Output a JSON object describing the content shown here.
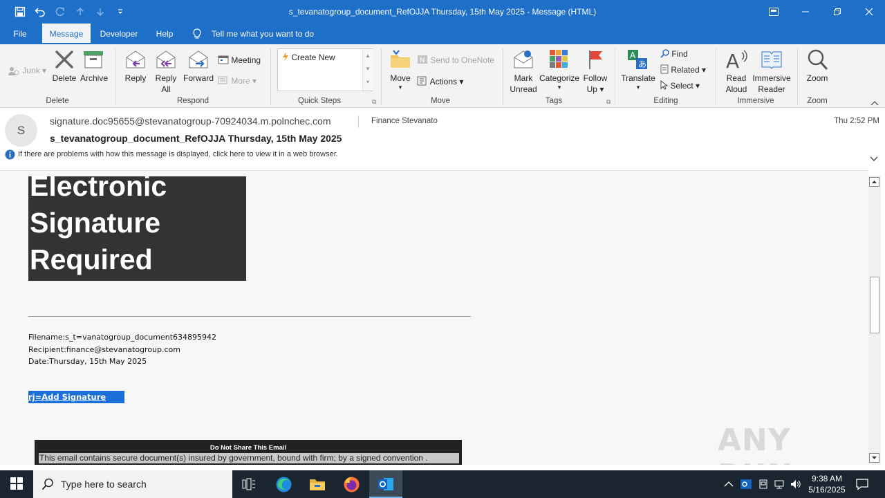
{
  "titlebar": {
    "title": "s_tevanatogroup_document_RefOJJA Thursday, 15th May 2025  -  Message (HTML)",
    "icons": [
      "save-icon",
      "undo-icon",
      "redo-icon",
      "up-arrow-icon",
      "down-arrow-icon",
      "customize-qat-icon"
    ],
    "window_controls": [
      "restore-ribbon-icon",
      "minimize-icon",
      "maximize-icon",
      "close-icon"
    ]
  },
  "tabs": [
    {
      "label": "File"
    },
    {
      "label": "Message"
    },
    {
      "label": "Developer"
    },
    {
      "label": "Help"
    }
  ],
  "tell_me": "Tell me what you want to do",
  "ribbon": {
    "delete_group": {
      "junk": "Junk",
      "delete": "Delete",
      "archive": "Archive",
      "label": "Delete"
    },
    "respond_group": {
      "reply": "Reply",
      "reply_all_1": "Reply",
      "reply_all_2": "All",
      "forward": "Forward",
      "meeting": "Meeting",
      "more": "More",
      "label": "Respond"
    },
    "quick_steps": {
      "create_new": "Create New",
      "label": "Quick Steps"
    },
    "move_group": {
      "move": "Move",
      "send_onenote": "Send to OneNote",
      "actions": "Actions",
      "label": "Move"
    },
    "tags_group": {
      "mark_1": "Mark",
      "mark_2": "Unread",
      "categorize": "Categorize",
      "follow_1": "Follow",
      "follow_2": "Up",
      "label": "Tags"
    },
    "editing_group": {
      "translate": "Translate",
      "find": "Find",
      "related": "Related",
      "select": "Select",
      "label": "Editing"
    },
    "immersive_group": {
      "read_1": "Read",
      "read_2": "Aloud",
      "immersive_1": "Immersive",
      "immersive_2": "Reader",
      "label": "Immersive"
    },
    "zoom_group": {
      "zoom": "Zoom",
      "label": "Zoom"
    }
  },
  "message": {
    "avatar_letter": "S",
    "from": "signature.doc95655@stevanatogroup-70924034.m.polnchec.com",
    "to": "Finance Stevanato",
    "subject": "s_tevanatogroup_document_RefOJJA Thursday, 15th May 2025",
    "time": "Thu 2:52 PM",
    "info_bar": "If there are problems with how this message is displayed, click here to view it in a web browser."
  },
  "body": {
    "banner_lines": [
      "Electronic",
      "Signature",
      "Required"
    ],
    "filename": "Filename:s_t=vanatogroup_document634895942",
    "recipient": "Recipient:finance@stevanatogroup.com",
    "date": "Date:Thursday, 15th May 2025",
    "link": "rj=Add Signature",
    "footer_title": "Do Not Share This Email",
    "footer_text": "This email contains secure document(s) insured by government, bound with firm; by a signed convention .",
    "watermark": "ANY RUN"
  },
  "taskbar": {
    "search_placeholder": "Type here to search",
    "time": "9:38 AM",
    "date": "5/16/2025"
  }
}
